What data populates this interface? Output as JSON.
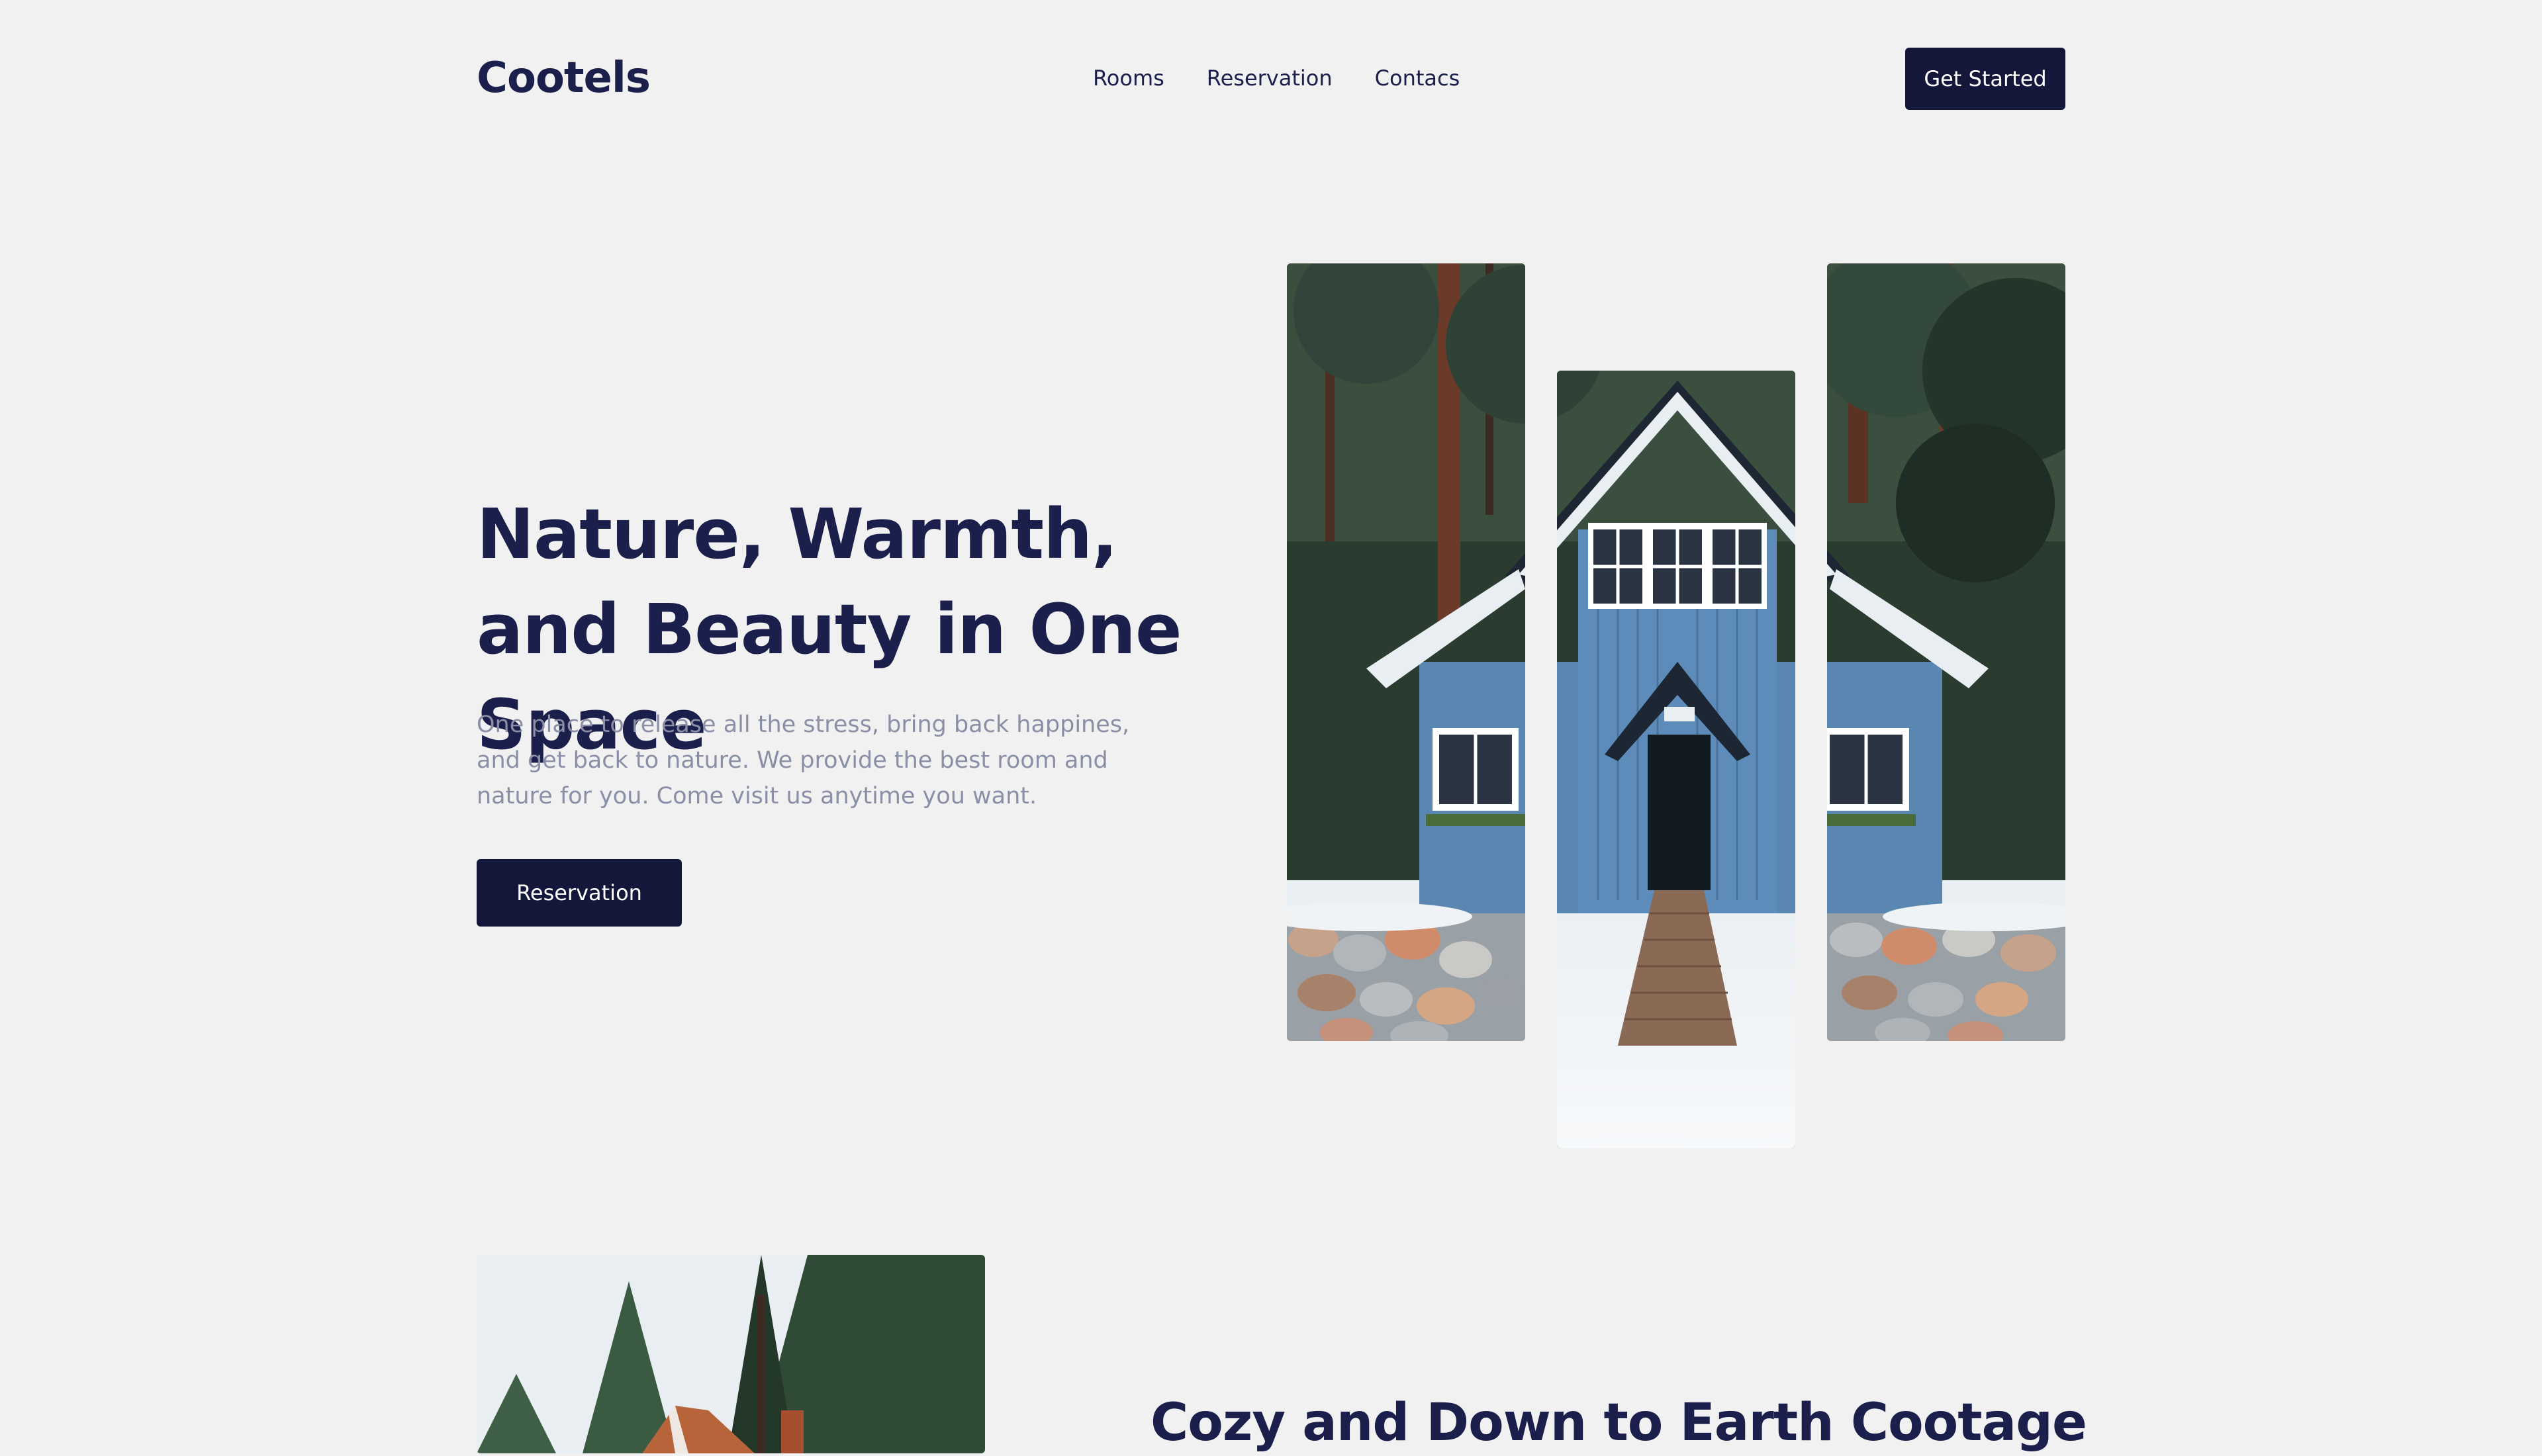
{
  "brand": {
    "name": "Cootels"
  },
  "nav": {
    "items": [
      {
        "label": "Rooms"
      },
      {
        "label": "Reservation"
      },
      {
        "label": "Contacs"
      }
    ],
    "cta_label": "Get Started"
  },
  "hero": {
    "title": "Nature, Warmth, and Beauty in One Space",
    "description": "One place to release all the stress, bring back happines, and get back to nature. We provide the best room and nature for you. Come visit us anytime you want.",
    "button_label": "Reservation"
  },
  "section": {
    "title": "Cozy and Down to Earth Cootage"
  },
  "colors": {
    "background": "#f1f1f1",
    "primary_text": "#1b1f4b",
    "button_bg": "#13183a",
    "muted_text": "#8b8fa6",
    "house_blue": "#5a86b2"
  }
}
